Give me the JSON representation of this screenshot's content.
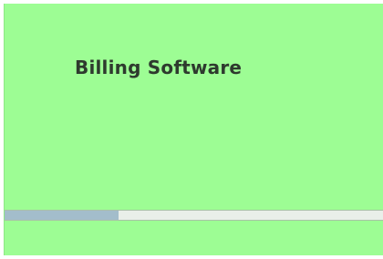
{
  "splash": {
    "title": "Billing Software",
    "background_color": "#9dfd94"
  },
  "progress": {
    "fraction": 0.3,
    "fill_color": "#a3bdcb",
    "track_color": "#e9efe9"
  }
}
